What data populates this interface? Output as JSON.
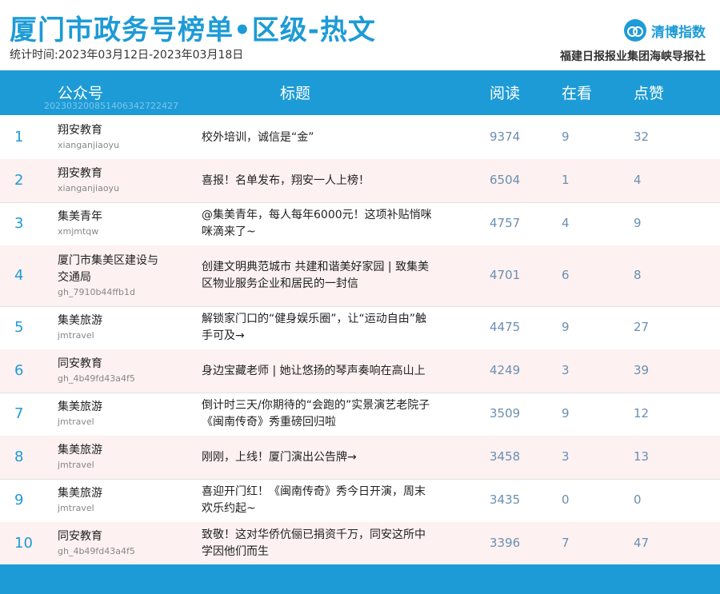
{
  "header": {
    "title": "厦门市政务号榜单•区级-热文",
    "period": "统计时间:2023年03月12日-2023年03月18日",
    "logo_text": "清博指数",
    "publisher": "福建日报报业集团海峡导报社"
  },
  "table": {
    "columns": {
      "account": "公众号",
      "title": "标题",
      "reads": "阅读",
      "watching": "在看",
      "likes": "点赞",
      "account_sub": "20230320085140634272242​7"
    },
    "rows": [
      {
        "rank": "1",
        "name": "翔安教育",
        "id": "xianganjiaoyu",
        "title": "校外培训，诚信是“金”",
        "reads": "9374",
        "watching": "9",
        "likes": "32"
      },
      {
        "rank": "2",
        "name": "翔安教育",
        "id": "xianganjiaoyu",
        "title": "喜报！名单发布，翔安一人上榜！",
        "reads": "6504",
        "watching": "1",
        "likes": "4"
      },
      {
        "rank": "3",
        "name": "集美青年",
        "id": "xmjmtqw",
        "title": "@集美青年，每人每年6000元！这项补贴悄咪咪滴来了~",
        "reads": "4757",
        "watching": "4",
        "likes": "9"
      },
      {
        "rank": "4",
        "name": "厦门市集美区建设与交通局",
        "id": "gh_7910b44ffb1d",
        "title": "创建文明典范城市 共建和谐美好家园 | 致集美区物业服务企业和居民的一封信",
        "reads": "4701",
        "watching": "6",
        "likes": "8"
      },
      {
        "rank": "5",
        "name": "集美旅游",
        "id": "jmtravel",
        "title": "解锁家门口的“健身娱乐圈”，让“运动自由”触手可及→",
        "reads": "4475",
        "watching": "9",
        "likes": "27"
      },
      {
        "rank": "6",
        "name": "同安教育",
        "id": "gh_4b49fd43a4f5",
        "title": "身边宝藏老师 | 她让悠扬的琴声奏响在高山上",
        "reads": "4249",
        "watching": "3",
        "likes": "39"
      },
      {
        "rank": "7",
        "name": "集美旅游",
        "id": "jmtravel",
        "title": "倒计时三天/你期待的“会跑的”实景演艺老院子《闽南传奇》秀重磅回归啦",
        "reads": "3509",
        "watching": "9",
        "likes": "12"
      },
      {
        "rank": "8",
        "name": "集美旅游",
        "id": "jmtravel",
        "title": "刚刚，上线！厦门演出公告牌→",
        "reads": "3458",
        "watching": "3",
        "likes": "13"
      },
      {
        "rank": "9",
        "name": "集美旅游",
        "id": "jmtravel",
        "title": "喜迎开门红！《闽南传奇》秀今日开演，周末欢乐约起~",
        "reads": "3435",
        "watching": "0",
        "likes": "0"
      },
      {
        "rank": "10",
        "name": "同安教育",
        "id": "gh_4b49fd43a4f5",
        "title": "致敬！这对华侨伉俪已捐资千万，同安这所中学因他们而生",
        "reads": "3396",
        "watching": "7",
        "likes": "47"
      }
    ]
  },
  "colors": {
    "accent": "#1d9bd6",
    "row_alt": "#fdf1f1"
  }
}
